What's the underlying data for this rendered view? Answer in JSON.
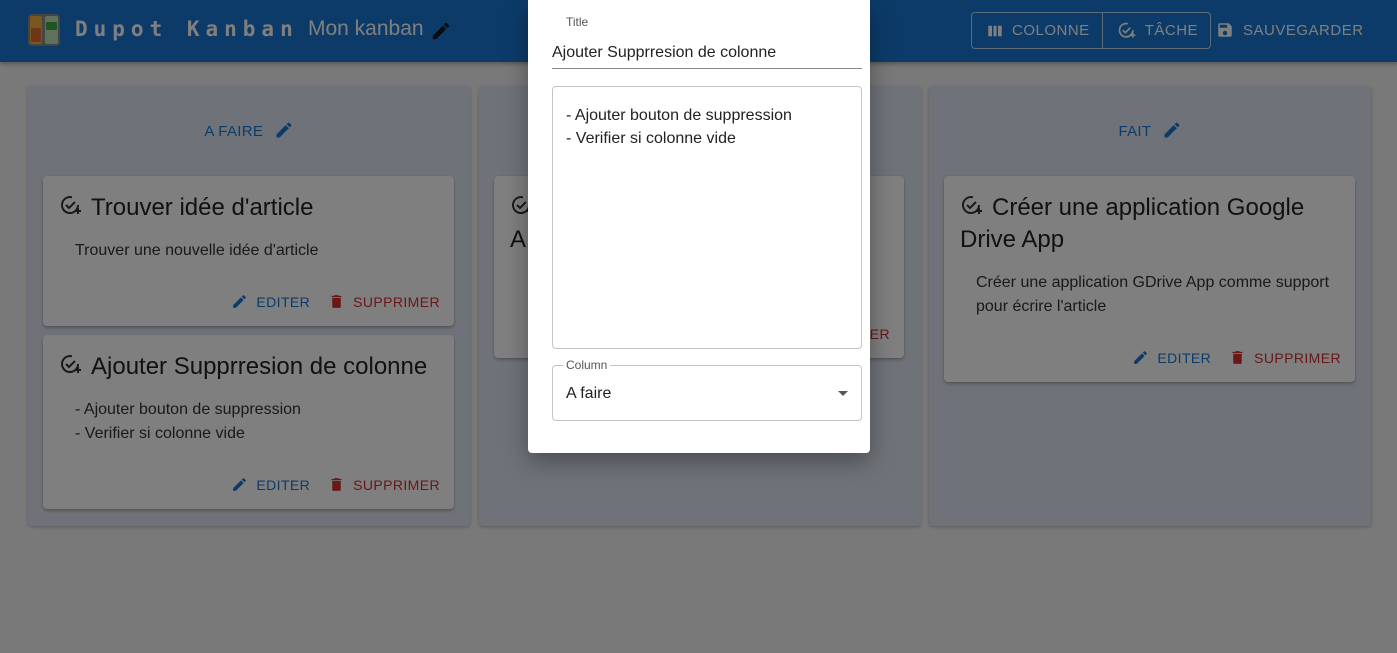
{
  "app": {
    "brand": "Dupot Kanban",
    "board_title": "Mon kanban",
    "buttons": {
      "column": "COLONNE",
      "task": "TÂCHE",
      "save": "SAUVEGARDER"
    }
  },
  "columns": [
    {
      "title": "A FAIRE",
      "cards": [
        {
          "title": "Trouver idée d'article",
          "description": "Trouver une nouvelle idée d'article"
        },
        {
          "title": "Ajouter Supprresion de colonne",
          "description": "- Ajouter bouton de suppression\n- Verifier si colonne vide"
        }
      ]
    },
    {
      "title": "",
      "cards": [
        {
          "title_fragment": "A",
          "description_fragment": ""
        }
      ]
    },
    {
      "title": "FAIT",
      "cards": [
        {
          "title": "Créer une application Google Drive App",
          "description": "Créer une application GDrive App comme support pour écrire l'article"
        }
      ]
    }
  ],
  "card_actions": {
    "edit": "EDITER",
    "delete": "SUPPRIMER"
  },
  "dialog": {
    "title_label": "Title",
    "title_value": "Ajouter Supprresion de colonne",
    "description_value": "- Ajouter bouton de suppression\n- Verifier si colonne vide",
    "column_label": "Column",
    "column_value": "A faire"
  },
  "colors": {
    "primary": "#1976d2",
    "danger": "#d32f2f",
    "column_bg": "#dfe7f2",
    "overlay": "rgba(0,0,0,0.5)"
  },
  "icons": [
    "kanban-logo-icon",
    "pencil-icon",
    "columns-icon",
    "task-add-icon",
    "save-icon",
    "check-add-icon",
    "delete-icon",
    "dropdown-arrow-icon"
  ]
}
